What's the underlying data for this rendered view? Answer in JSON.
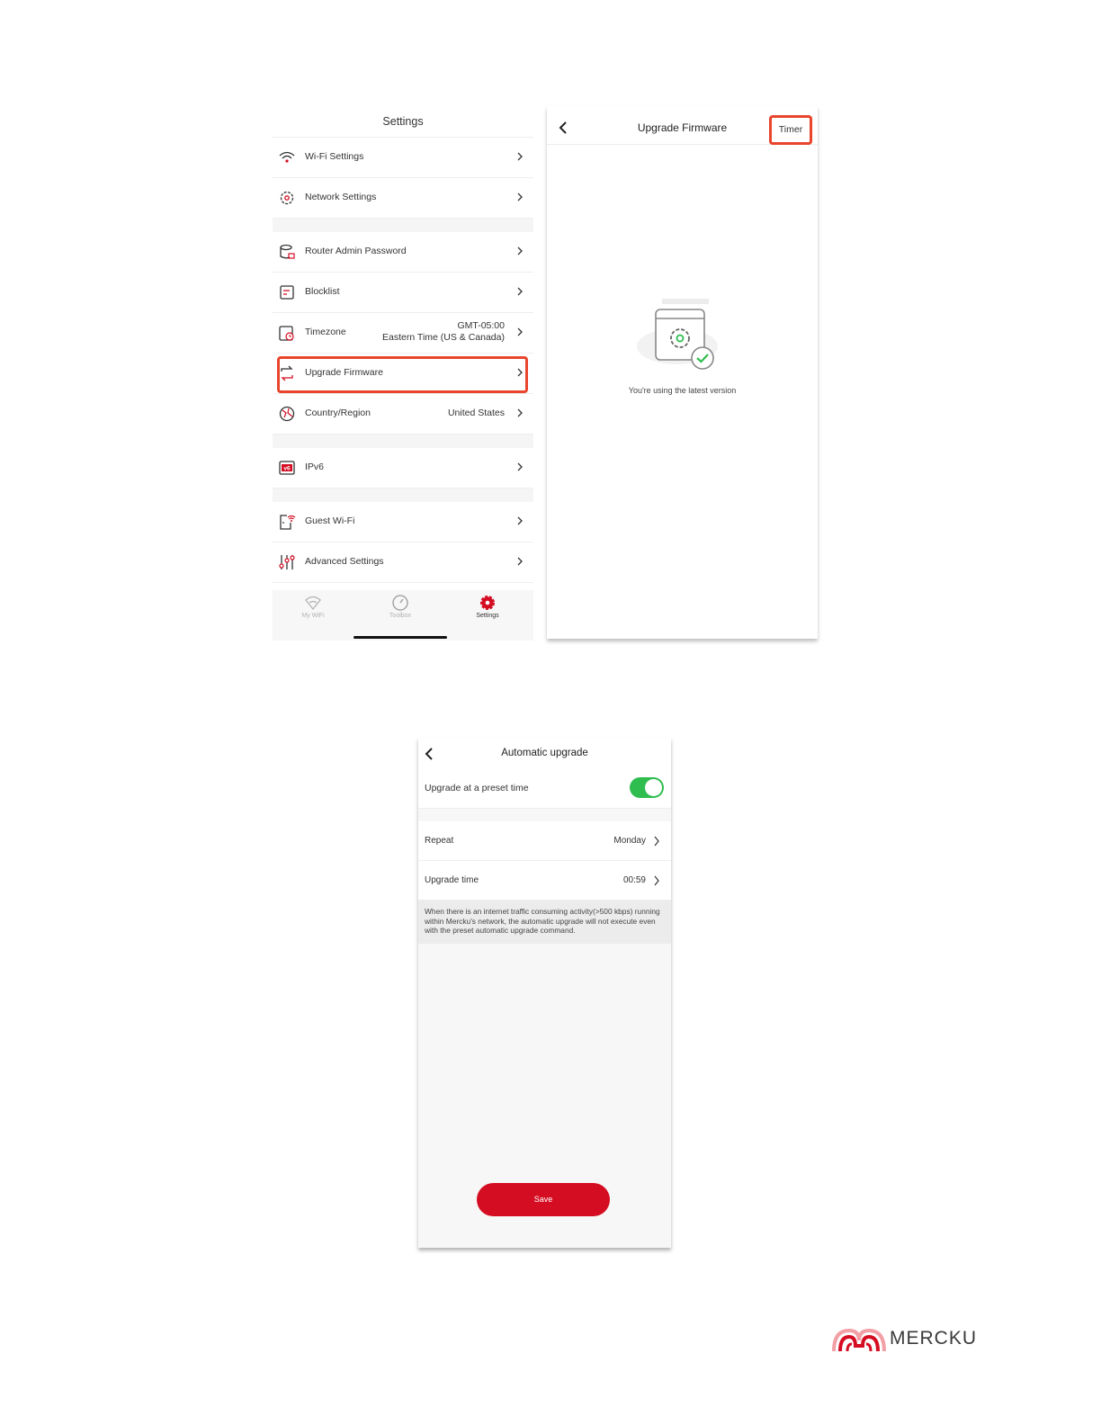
{
  "settings_screen": {
    "title": "Settings",
    "items": [
      {
        "label": "Wi-Fi Settings",
        "icon": "wifi-icon"
      },
      {
        "label": "Network Settings",
        "icon": "gear-icon"
      },
      {
        "label": "Router Admin Password",
        "icon": "router-lock-icon"
      },
      {
        "label": "Blocklist",
        "icon": "blocklist-icon"
      },
      {
        "label": "Timezone",
        "icon": "timezone-icon",
        "value_line1": "GMT-05:00",
        "value_line2": "Eastern Time (US & Canada)"
      },
      {
        "label": "Upgrade Firmware",
        "icon": "upgrade-icon"
      },
      {
        "label": "Country/Region",
        "icon": "globe-icon",
        "value": "United States"
      },
      {
        "label": "IPv6",
        "icon": "ipv6-icon"
      },
      {
        "label": "Guest Wi-Fi",
        "icon": "guest-wifi-icon"
      },
      {
        "label": "Advanced Settings",
        "icon": "sliders-icon"
      }
    ],
    "tabs": [
      {
        "label": "My WiFi",
        "icon": "wifi-icon"
      },
      {
        "label": "Toolbox",
        "icon": "gauge-icon"
      },
      {
        "label": "Settings",
        "icon": "gear-icon"
      }
    ]
  },
  "firmware_screen": {
    "title": "Upgrade Firmware",
    "timer_label": "Timer",
    "status_text": "You're using the latest version"
  },
  "auto_screen": {
    "title": "Automatic upgrade",
    "preset_label": "Upgrade at a preset time",
    "preset_enabled": true,
    "repeat_label": "Repeat",
    "repeat_value": "Monday",
    "time_label": "Upgrade time",
    "time_value": "00:59",
    "note": "When there is an internet traffic consuming activity(>500 kbps) running within Mercku's network, the automatic upgrade will not execute even with the preset automatic upgrade command.",
    "save_label": "Save"
  },
  "logo": {
    "text": "MERCKU"
  },
  "colors": {
    "accent": "#d50d22",
    "highlight": "#e8452c",
    "toggle_on": "#2fbd4f"
  }
}
